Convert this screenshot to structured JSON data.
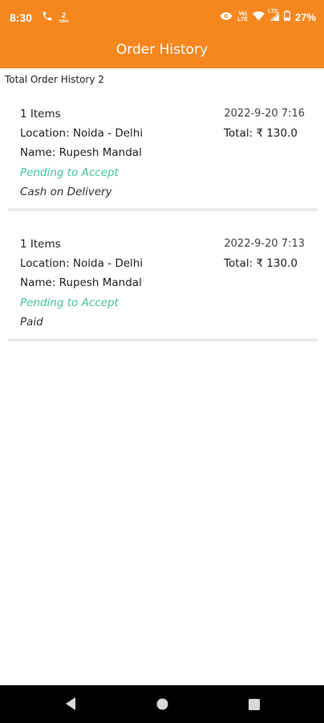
{
  "status_bar": {
    "time": "8:30",
    "battery": "27%",
    "volte_top": "Vo)",
    "volte_bottom": "LTE",
    "lte": "LTE",
    "data_top": "2",
    "data_bottom": "KB/s"
  },
  "app_bar": {
    "title": "Order History"
  },
  "summary": {
    "total_label": "Total Order History 2"
  },
  "orders": [
    {
      "items": "1 Items",
      "date": "2022-9-20 7:16",
      "location": "Location: Noida - Delhi",
      "total": "Total: ₹ 130.0",
      "name": "Name: Rupesh Mandal",
      "status": "Pending to Accept",
      "payment": "Cash on Delivery"
    },
    {
      "items": "1 Items",
      "date": "2022-9-20 7:13",
      "location": "Location: Noida - Delhi",
      "total": "Total: ₹ 130.0",
      "name": "Name: Rupesh Mandal",
      "status": "Pending to Accept",
      "payment": "Paid"
    }
  ],
  "colors": {
    "accent": "#f6871f",
    "status_pending": "#45c3a0",
    "nav_background": "#000000"
  },
  "icons": {
    "status_left": [
      "phone-icon",
      "data-speed-icon"
    ],
    "status_right": [
      "eye-icon",
      "volte-icon",
      "wifi-icon",
      "signal-icon",
      "battery-icon"
    ],
    "nav": [
      "back-icon",
      "home-icon",
      "recents-icon"
    ]
  }
}
